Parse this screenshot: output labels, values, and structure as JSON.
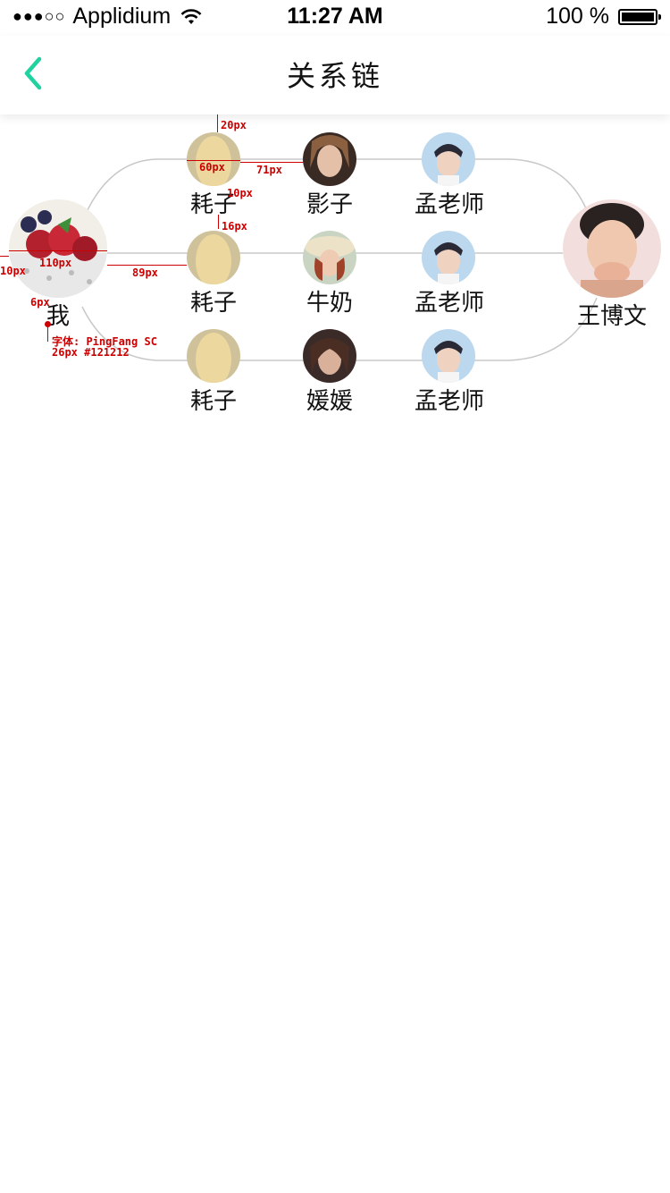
{
  "status_bar": {
    "carrier": "Applidium",
    "time": "11:27 AM",
    "battery": "100 %"
  },
  "header": {
    "title": "关系链",
    "back_icon": "chevron-left-icon",
    "accent": "#1fd2a0"
  },
  "chain": {
    "me": {
      "name": "我"
    },
    "target": {
      "name": "王博文"
    },
    "rows": [
      [
        "耗子",
        "影子",
        "孟老师"
      ],
      [
        "耗子",
        "牛奶",
        "孟老师"
      ],
      [
        "耗子",
        "媛媛",
        "孟老师"
      ]
    ]
  },
  "annotations": {
    "top_gap": "20px",
    "avatar_small": "60px",
    "col_gap": "71px",
    "name_gap": "10px",
    "row_gap": "16px",
    "left_margin": "10px",
    "avatar_large": "110px",
    "me_gap": "89px",
    "me_name_gap": "6px",
    "font_note_1": "字体: PingFang SC",
    "font_note_2": "26px #121212"
  }
}
